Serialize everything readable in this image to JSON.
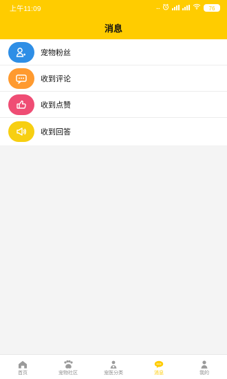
{
  "status_bar": {
    "time": "上午11:09",
    "dots": "...",
    "battery": "76"
  },
  "header": {
    "title": "消息"
  },
  "messages": {
    "items": [
      {
        "label": "宠物粉丝",
        "icon": "user-icon",
        "color": "#2e8ee6"
      },
      {
        "label": "收到评论",
        "icon": "comment-icon",
        "color": "#ff9a2f"
      },
      {
        "label": "收到点赞",
        "icon": "thumbs-up-icon",
        "color": "#ef4d74"
      },
      {
        "label": "收到回答",
        "icon": "speaker-icon",
        "color": "#f7cf12"
      }
    ]
  },
  "bottom_nav": {
    "items": [
      {
        "label": "首页",
        "icon": "home-icon"
      },
      {
        "label": "宠物社区",
        "icon": "paw-icon"
      },
      {
        "label": "宠医分类",
        "icon": "doctor-icon"
      },
      {
        "label": "消息",
        "icon": "message-icon",
        "active": true
      },
      {
        "label": "我的",
        "icon": "profile-icon"
      }
    ]
  },
  "colors": {
    "accent": "#ffcc00"
  }
}
